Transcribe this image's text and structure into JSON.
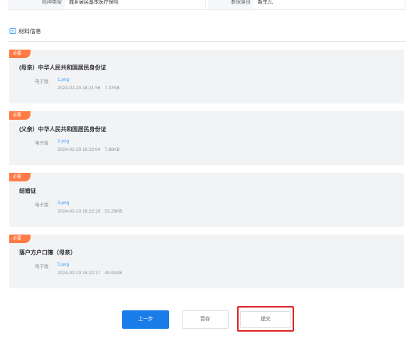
{
  "info_row": {
    "label1": "险种类型",
    "value1": "城乡居民基本医疗保险",
    "label2": "参保身份",
    "value2": "新生儿"
  },
  "section": {
    "title": "材料信息",
    "icon": "document-icon"
  },
  "materials": [
    {
      "badge": "必要",
      "title": "(母亲）中华人民共和国居民身份证",
      "file_label": "电子版",
      "file_name": "1.png",
      "date": "2024-02-20 18:21:56",
      "size": "7.37KB"
    },
    {
      "badge": "必要",
      "title": "(父亲）中华人民共和国居民身份证",
      "file_label": "电子版",
      "file_name": "2.png",
      "date": "2024-02-20 18:22:04",
      "size": "7.98KB"
    },
    {
      "badge": "必要",
      "title": "结婚证",
      "file_label": "电子版",
      "file_name": "3.png",
      "date": "2024-02-20 18:22:10",
      "size": "53.29KB"
    },
    {
      "badge": "必要",
      "title": "落户方户口簿（母亲）",
      "file_label": "电子版",
      "file_name": "5.png",
      "date": "2024-02-20 18:22:17",
      "size": "49.91KB"
    }
  ],
  "buttons": {
    "prev": "上一步",
    "save": "暂存",
    "submit": "提交"
  },
  "colors": {
    "primary": "#1a7ce8",
    "badge": "#ff7a45",
    "link": "#409eff",
    "highlight": "#e02020",
    "card_bg": "#f2f3f5"
  }
}
